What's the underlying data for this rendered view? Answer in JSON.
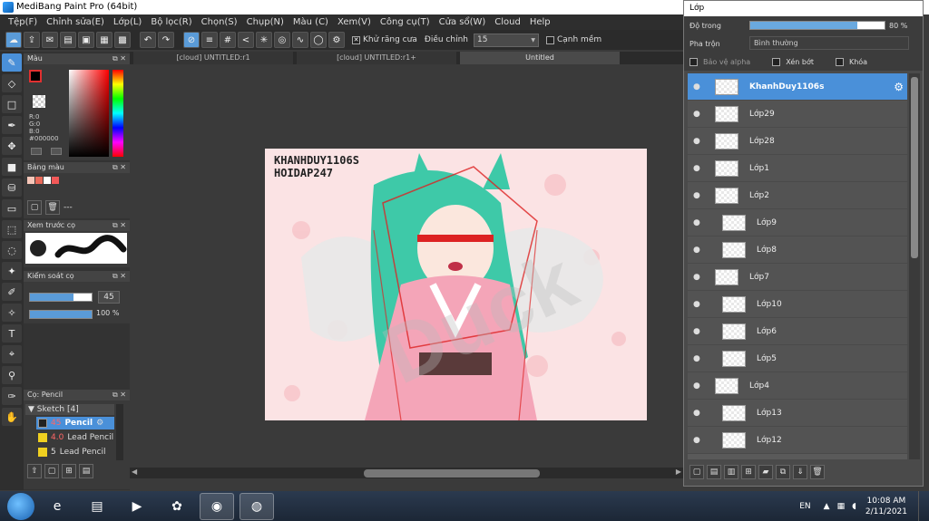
{
  "app": {
    "title": "MediBang Paint Pro (64bit)"
  },
  "menu": [
    "Tệp(F)",
    "Chỉnh sửa(E)",
    "Lớp(L)",
    "Bộ lọc(R)",
    "Chọn(S)",
    "Chụp(N)",
    "Màu (C)",
    "Xem(V)",
    "Công cụ(T)",
    "Cửa sổ(W)",
    "Cloud",
    "Help"
  ],
  "toolbar": {
    "antialias_label": "Khử răng cưa",
    "correction_label": "Điều chỉnh",
    "correction_value": "15",
    "snap_label": "Cạnh mềm"
  },
  "tabs": [
    "[cloud] UNTITLED:r1",
    "[cloud] UNTITLED:r1+",
    "Untitled"
  ],
  "color_panel": {
    "title": "Màu",
    "r": "R:0",
    "g": "G:0",
    "b": "B:0",
    "hex": "#000000"
  },
  "palette_panel": {
    "title": "Bảng màu",
    "dash": "---"
  },
  "brush_preview_panel": {
    "title": "Xem trước cọ"
  },
  "brush_control_panel": {
    "title": "Kiểm soát cọ",
    "size": "45",
    "opacity": "100 %"
  },
  "brush_list_panel": {
    "title": "Cọ: Pencil",
    "group": "Sketch [4]",
    "items": [
      {
        "size": "45",
        "name": "Pencil",
        "selected": true
      },
      {
        "size": "4.0",
        "name": "Lead Pencil",
        "selected": false
      },
      {
        "size": "5",
        "name": "Lead Pencil",
        "selected": false
      }
    ]
  },
  "artwork": {
    "line1": "KHANHDUY1106S",
    "line2": "HOIDAP247"
  },
  "layer_window": {
    "title": "Lớp",
    "opacity_label": "Độ trong",
    "opacity_value": "80 %",
    "opacity_fraction": 0.8,
    "blend_label": "Pha trộn",
    "blend_value": "Bình thường",
    "protect_alpha": "Bảo vệ alpha",
    "clipping": "Xén bớt",
    "lock": "Khóa",
    "layers": [
      {
        "name": "KhanhDuy1106s",
        "selected": true,
        "child": false
      },
      {
        "name": "Lớp29",
        "selected": false,
        "child": false
      },
      {
        "name": "Lớp28",
        "selected": false,
        "child": false
      },
      {
        "name": "Lớp1",
        "selected": false,
        "child": false
      },
      {
        "name": "Lớp2",
        "selected": false,
        "child": false
      },
      {
        "name": "Lớp9",
        "selected": false,
        "child": true
      },
      {
        "name": "Lớp8",
        "selected": false,
        "child": true
      },
      {
        "name": "Lớp7",
        "selected": false,
        "child": false
      },
      {
        "name": "Lớp10",
        "selected": false,
        "child": true
      },
      {
        "name": "Lớp6",
        "selected": false,
        "child": true
      },
      {
        "name": "Lớp5",
        "selected": false,
        "child": true
      },
      {
        "name": "Lớp4",
        "selected": false,
        "child": false
      },
      {
        "name": "Lớp13",
        "selected": false,
        "child": true
      },
      {
        "name": "Lớp12",
        "selected": false,
        "child": true
      }
    ]
  },
  "taskbar": {
    "language": "EN",
    "time": "10:08 AM",
    "date": "2/11/2021"
  }
}
